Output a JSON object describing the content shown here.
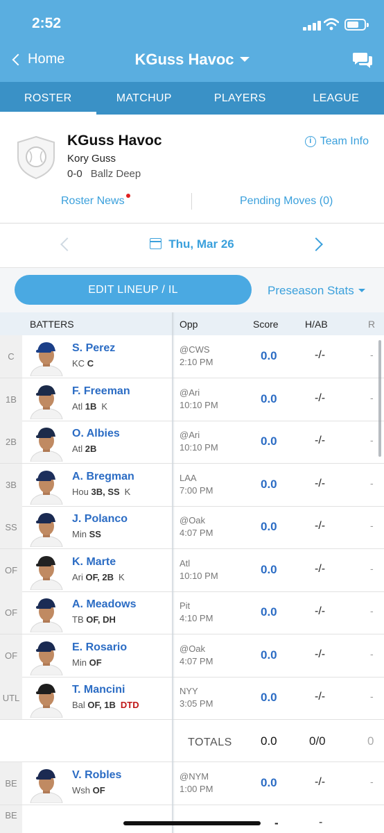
{
  "status": {
    "time": "2:52"
  },
  "nav": {
    "back_label": "Home",
    "title": "KGuss Havoc"
  },
  "tabs": [
    "ROSTER",
    "MATCHUP",
    "PLAYERS",
    "LEAGUE"
  ],
  "team": {
    "name": "KGuss Havoc",
    "manager": "Kory Guss",
    "record": "0-0",
    "league": "Ballz Deep",
    "team_info": "Team Info",
    "roster_news": "Roster News",
    "pending_moves": "Pending Moves (0)"
  },
  "date": {
    "label": "Thu, Mar 26"
  },
  "actions": {
    "edit_lineup": "EDIT LINEUP / IL",
    "stats_selector": "Preseason Stats"
  },
  "table": {
    "headers": {
      "batters": "BATTERS",
      "opp": "Opp",
      "score": "Score",
      "hab": "H/AB",
      "r": "R"
    },
    "rows": [
      {
        "pos": "C",
        "name": "S. Perez",
        "team": "KC",
        "positions": "C",
        "tag": "",
        "opp": "@CWS",
        "time": "2:10 PM",
        "score": "0.0",
        "hab": "-/-",
        "r": "-",
        "cap": "#1b3f88"
      },
      {
        "pos": "1B",
        "name": "F. Freeman",
        "team": "Atl",
        "positions": "1B",
        "tag": "K",
        "opp": "@Ari",
        "time": "10:10 PM",
        "score": "0.0",
        "hab": "-/-",
        "r": "-",
        "cap": "#1c2b4a"
      },
      {
        "pos": "2B",
        "name": "O. Albies",
        "team": "Atl",
        "positions": "2B",
        "tag": "",
        "opp": "@Ari",
        "time": "10:10 PM",
        "score": "0.0",
        "hab": "-/-",
        "r": "-",
        "cap": "#1c2b4a"
      },
      {
        "pos": "3B",
        "name": "A. Bregman",
        "team": "Hou",
        "positions": "3B, SS",
        "tag": "K",
        "opp": "LAA",
        "time": "7:00 PM",
        "score": "0.0",
        "hab": "-/-",
        "r": "-",
        "cap": "#1d2f5c"
      },
      {
        "pos": "SS",
        "name": "J. Polanco",
        "team": "Min",
        "positions": "SS",
        "tag": "",
        "opp": "@Oak",
        "time": "4:07 PM",
        "score": "0.0",
        "hab": "-/-",
        "r": "-",
        "cap": "#1a2a52"
      },
      {
        "pos": "OF",
        "name": "K. Marte",
        "team": "Ari",
        "positions": "OF, 2B",
        "tag": "K",
        "opp": "Atl",
        "time": "10:10 PM",
        "score": "0.0",
        "hab": "-/-",
        "r": "-",
        "cap": "#222222"
      },
      {
        "pos": "OF",
        "name": "A. Meadows",
        "team": "TB",
        "positions": "OF, DH",
        "tag": "",
        "opp": "Pit",
        "time": "4:10 PM",
        "score": "0.0",
        "hab": "-/-",
        "r": "-",
        "cap": "#1b2c55"
      },
      {
        "pos": "OF",
        "name": "E. Rosario",
        "team": "Min",
        "positions": "OF",
        "tag": "",
        "opp": "@Oak",
        "time": "4:07 PM",
        "score": "0.0",
        "hab": "-/-",
        "r": "-",
        "cap": "#1a2a52"
      },
      {
        "pos": "UTL",
        "name": "T. Mancini",
        "team": "Bal",
        "positions": "OF, 1B",
        "tag": "",
        "dtd": "DTD",
        "opp": "NYY",
        "time": "3:05 PM",
        "score": "0.0",
        "hab": "-/-",
        "r": "-",
        "cap": "#1e1e1e"
      }
    ],
    "totals": {
      "label": "TOTALS",
      "score": "0.0",
      "hab": "0/0",
      "r": "0"
    },
    "bench": [
      {
        "pos": "BE",
        "name": "V. Robles",
        "team": "Wsh",
        "positions": "OF",
        "tag": "",
        "opp": "@NYM",
        "time": "1:00 PM",
        "score": "0.0",
        "hab": "-/-",
        "r": "-",
        "cap": "#1b2a52"
      }
    ],
    "bench_empty": {
      "pos": "BE",
      "opp": "-",
      "score": "-",
      "hab": "-"
    }
  }
}
